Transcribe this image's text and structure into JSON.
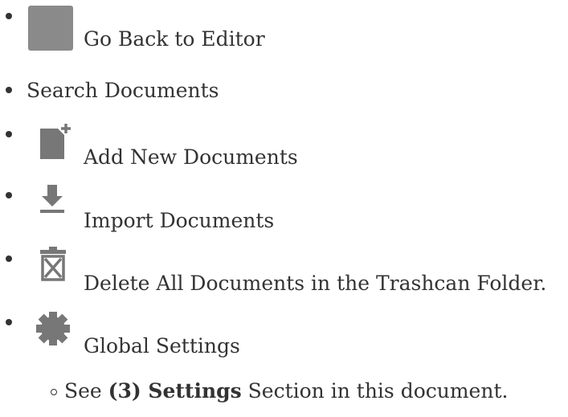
{
  "items": [
    {
      "icon": "editor-thumbnail-icon",
      "label": "Go Back to Editor"
    },
    {
      "label": "Search Documents"
    },
    {
      "icon": "add-document-icon",
      "label": "Add New Documents"
    },
    {
      "icon": "import-download-icon",
      "label": "Import Documents"
    },
    {
      "icon": "trashcan-icon",
      "label": "Delete All Documents in the Trashcan Folder."
    },
    {
      "icon": "gear-icon",
      "label": "Global Settings"
    }
  ],
  "sub_item": {
    "prefix": "See ",
    "emphasis": "(3) Settings",
    "suffix": " Section in this document."
  },
  "colors": {
    "text": "#333333",
    "icon": "#777777",
    "thumbnail": "#8a8a8a"
  }
}
